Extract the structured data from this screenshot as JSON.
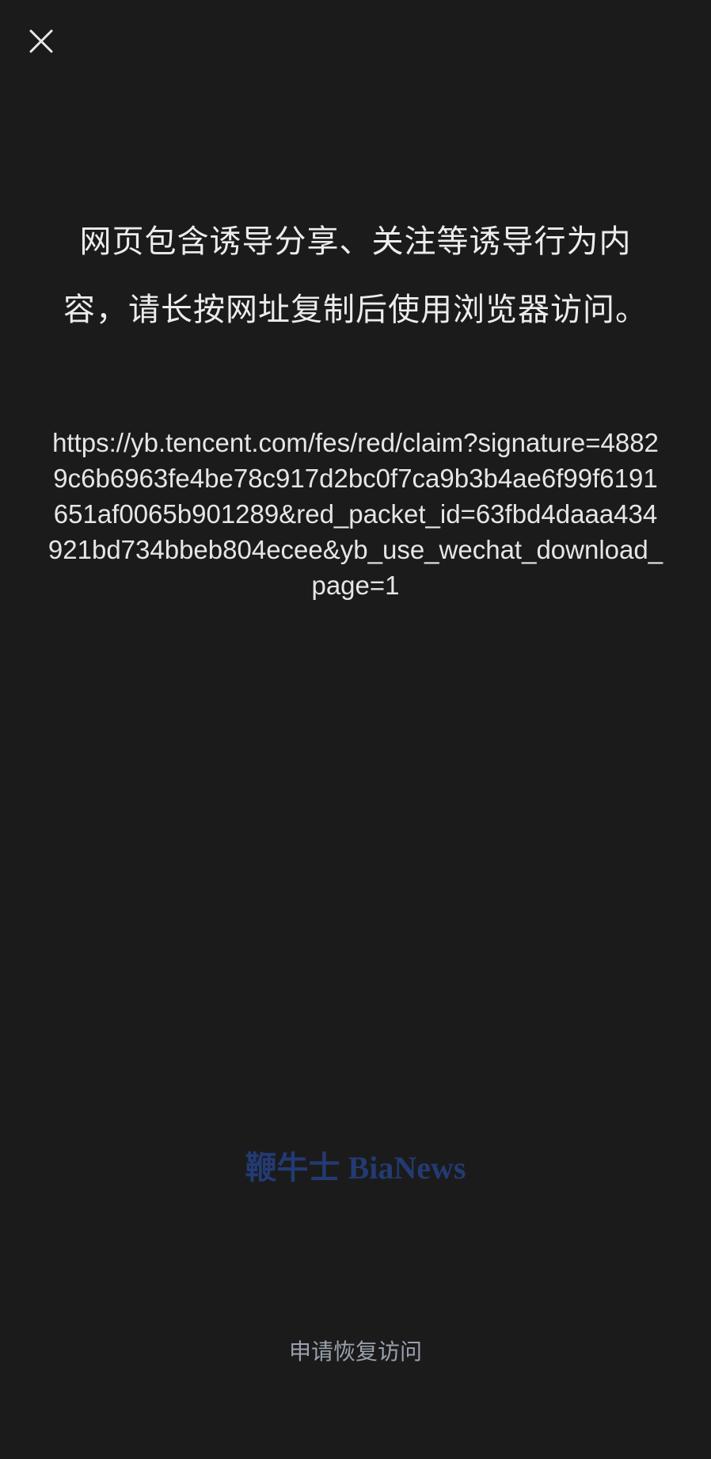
{
  "header": {
    "close_icon": "close-icon"
  },
  "content": {
    "warning_message": "网页包含诱导分享、关注等诱导行为内容，请长按网址复制后使用浏览器访问。",
    "blocked_url": "https://yb.tencent.com/fes/red/claim?signature=48829c6b6963fe4be78c917d2bc0f7ca9b3b4ae6f99f6191651af0065b901289&red_packet_id=63fbd4daaa434921bd734bbeb804ecee&yb_use_wechat_download_page=1"
  },
  "watermark": {
    "text": "鞭牛士 BiaNews"
  },
  "footer": {
    "request_restore_label": "申请恢复访问"
  },
  "colors": {
    "background": "#1b1b1b",
    "primary_text": "#ececec",
    "secondary_text": "#9aa1ad",
    "watermark": "#243c78"
  }
}
